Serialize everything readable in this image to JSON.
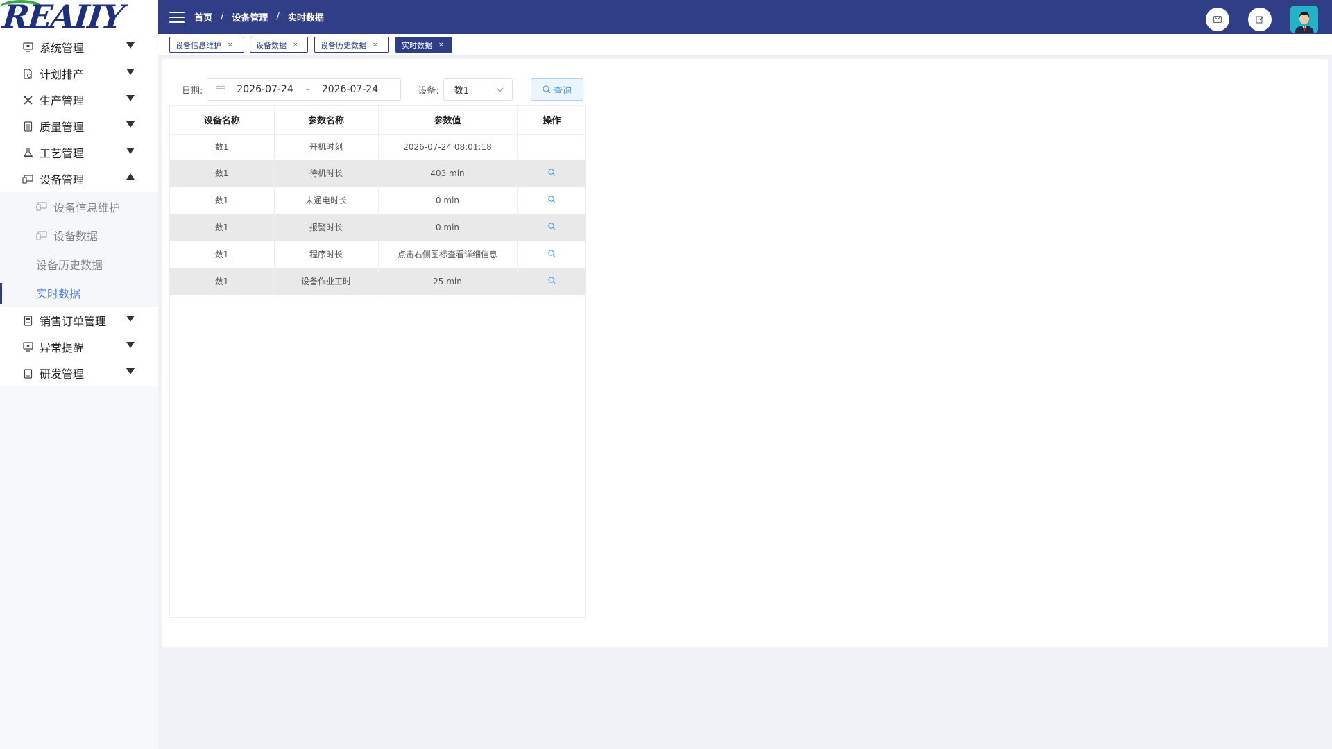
{
  "logo": {
    "text": "REAIIY"
  },
  "sidebar": {
    "items": [
      {
        "label": "系统管理",
        "icon": "monitor-icon",
        "expanded": false
      },
      {
        "label": "计划排产",
        "icon": "document-schedule-icon",
        "expanded": false
      },
      {
        "label": "生产管理",
        "icon": "tools-icon",
        "expanded": false
      },
      {
        "label": "质量管理",
        "icon": "document-icon",
        "expanded": false
      },
      {
        "label": "工艺管理",
        "icon": "flask-icon",
        "expanded": false
      },
      {
        "label": "设备管理",
        "icon": "device-icon",
        "expanded": true
      },
      {
        "label": "销售订单管理",
        "icon": "receipt-icon",
        "expanded": false
      },
      {
        "label": "异常提醒",
        "icon": "monitor-alert-icon",
        "expanded": false
      },
      {
        "label": "研发管理",
        "icon": "calendar-icon",
        "expanded": false
      }
    ],
    "submenu": [
      {
        "label": "设备信息维护",
        "icon": "device-icon",
        "active": false
      },
      {
        "label": "设备数据",
        "icon": "device-icon",
        "active": false
      },
      {
        "label": "设备历史数据",
        "icon": "",
        "active": false
      },
      {
        "label": "实时数据",
        "icon": "",
        "active": true
      }
    ]
  },
  "header": {
    "breadcrumb": [
      "首页",
      "设备管理",
      "实时数据"
    ],
    "separator": "/"
  },
  "tags": [
    {
      "label": "设备信息维护",
      "close": "×",
      "active": false
    },
    {
      "label": "设备数据",
      "close": "×",
      "active": false
    },
    {
      "label": "设备历史数据",
      "close": "×",
      "active": false
    },
    {
      "label": "实时数据",
      "close": "×",
      "active": true
    }
  ],
  "filter": {
    "date_label": "日期:",
    "date_start": "2026-07-24",
    "date_sep": "-",
    "date_end": "2026-07-24",
    "device_label": "设备:",
    "device_value": "数1",
    "query_label": "查询"
  },
  "table": {
    "columns": [
      "设备名称",
      "参数名称",
      "参数值",
      "操作"
    ],
    "rows": [
      {
        "device": "数1",
        "param": "开机时刻",
        "value": "2026-07-24 08:01:18",
        "has_action": false
      },
      {
        "device": "数1",
        "param": "待机时长",
        "value": "403 min",
        "has_action": true
      },
      {
        "device": "数1",
        "param": "未通电时长",
        "value": "0 min",
        "has_action": true
      },
      {
        "device": "数1",
        "param": "报警时长",
        "value": "0 min",
        "has_action": true
      },
      {
        "device": "数1",
        "param": "程序时长",
        "value": "点击右侧图标查看详细信息",
        "has_action": true
      },
      {
        "device": "数1",
        "param": "设备作业工时",
        "value": "25 min",
        "has_action": true
      }
    ]
  },
  "colors": {
    "primary": "#2f3e86",
    "link": "#409eff",
    "active_menu": "#4c7ae0"
  }
}
